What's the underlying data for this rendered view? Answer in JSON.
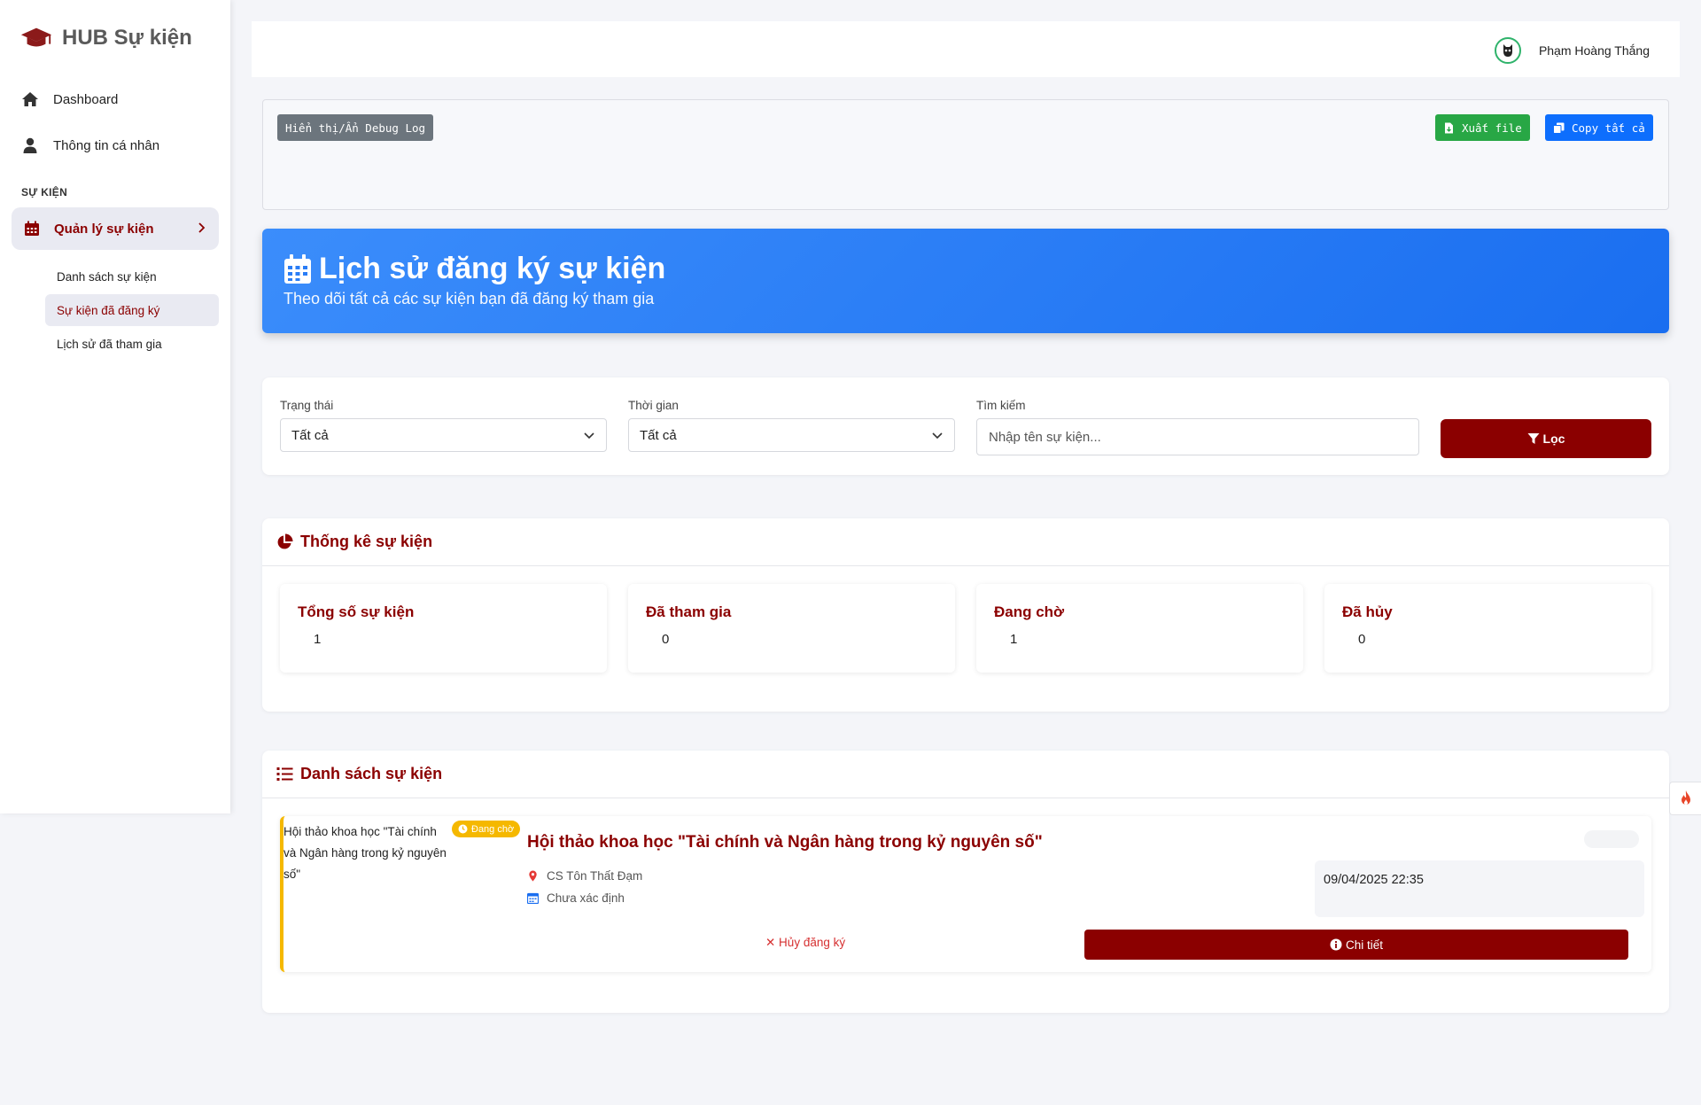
{
  "app": {
    "brand": "HUB Sự kiện"
  },
  "sidebar": {
    "items": [
      {
        "label": "Dashboard",
        "icon": "home-icon"
      },
      {
        "label": "Thông tin cá nhân",
        "icon": "user-icon"
      }
    ],
    "section_label": "SỰ KIỆN",
    "active_group": {
      "label": "Quản lý sự kiện",
      "icon": "calendar-icon"
    },
    "sub_items": [
      {
        "label": "Danh sách sự kiện"
      },
      {
        "label": "Sự kiện đã đăng ký",
        "active": true
      },
      {
        "label": "Lịch sử đã tham gia"
      }
    ]
  },
  "topbar": {
    "user_name": "Phạm Hoàng Thắng"
  },
  "debug": {
    "toggle_label": "Hiển thị/Ẩn Debug Log",
    "export_label": "Xuất file",
    "copy_label": "Copy tất cả"
  },
  "hero": {
    "title": "Lịch sử đăng ký sự kiện",
    "subtitle": "Theo dõi tất cả các sự kiện bạn đã đăng ký tham gia"
  },
  "filters": {
    "status_label": "Trạng thái",
    "status_value": "Tất cả",
    "time_label": "Thời gian",
    "time_value": "Tất cả",
    "search_label": "Tìm kiếm",
    "search_placeholder": "Nhập tên sự kiện...",
    "filter_button": "Lọc"
  },
  "stats": {
    "heading": "Thống kê sự kiện",
    "boxes": [
      {
        "title": "Tổng số sự kiện",
        "value": "1"
      },
      {
        "title": "Đã tham gia",
        "value": "0"
      },
      {
        "title": "Đang chờ",
        "value": "1"
      },
      {
        "title": "Đã hủy",
        "value": "0"
      }
    ]
  },
  "events": {
    "heading": "Danh sách sự kiện",
    "items": [
      {
        "thumb_text": "Hội thảo khoa học \"Tài chính và Ngân hàng trong kỷ nguyên số\"",
        "status": "Đang chờ",
        "title": "Hội thảo khoa học \"Tài chính và Ngân hàng trong kỷ nguyên số\"",
        "location": "CS Tôn Thất Đạm",
        "date_info": "Chưa xác định",
        "registered_at": "09/04/2025 22:35",
        "cancel_label": "✕ Hủy đăng ký",
        "detail_label": "Chi tiết"
      }
    ]
  },
  "colors": {
    "brand": "#8b0000",
    "accent": "#1a6ef0",
    "pending": "#f5b800"
  }
}
